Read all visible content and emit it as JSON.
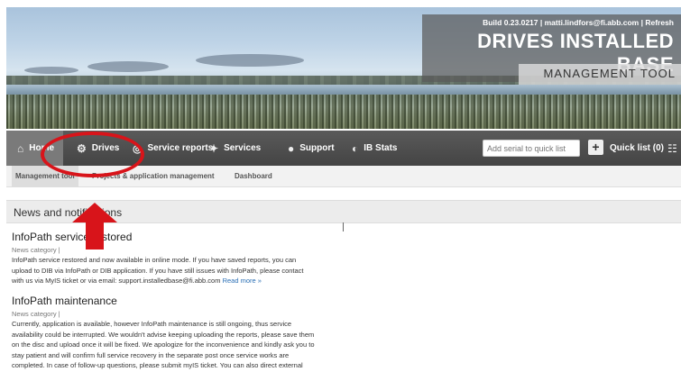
{
  "header": {
    "build_line": "Build 0.23.0217  |  matti.lindfors@fi.abb.com  |  Refresh",
    "title": "DRIVES INSTALLED BASE",
    "subtitle": "MANAGEMENT TOOL"
  },
  "nav": {
    "items": [
      {
        "label": "Home",
        "icon": "home-icon"
      },
      {
        "label": "Drives",
        "icon": "gear-icon"
      },
      {
        "label": "Service reports",
        "icon": "globe-icon"
      },
      {
        "label": "Services",
        "icon": "wrench-icon"
      },
      {
        "label": "Support",
        "icon": "chat-icon"
      },
      {
        "label": "IB Stats",
        "icon": "gauge-icon"
      }
    ],
    "quick_input_placeholder": "Add serial to quick list",
    "plus_label": "+",
    "quick_list_label": "Quick list (0)",
    "basket_icon": "basket-icon"
  },
  "subnav": {
    "items": [
      "Management tool",
      "Projects & application management",
      "Dashboard"
    ]
  },
  "news": {
    "heading": "News and notifications",
    "articles": [
      {
        "title": "InfoPath service restored",
        "category": "News category  |",
        "body_lines": [
          "InfoPath service restored and now available in online mode. If you have saved reports, you can",
          "upload to DIB via InfoPath or DIB application. If you have still issues with InfoPath, please contact",
          "with us via MyIS ticket or via email: support.installedbase@fi.abb.com"
        ],
        "read_more": "Read more »"
      },
      {
        "title": "InfoPath maintenance",
        "category": "News category  |",
        "body_lines": [
          "Currently, application is available, however InfoPath maintenance is still ongoing, thus service",
          "availability could be interrupted. We wouldn't advise keeping uploading the reports, please save them",
          "on the disc and upload once it will be fixed. We apologize for the inconvenience and kindly ask you to",
          "stay patient and will confirm full service recovery in the separate post once service works are",
          "completed. In case of follow-up questions, please submit myIS ticket. You can also direct external"
        ]
      }
    ]
  },
  "colors": {
    "nav_bg": "#4d4d4d",
    "annotation_red": "#d8141a",
    "link": "#2a6fb5"
  }
}
